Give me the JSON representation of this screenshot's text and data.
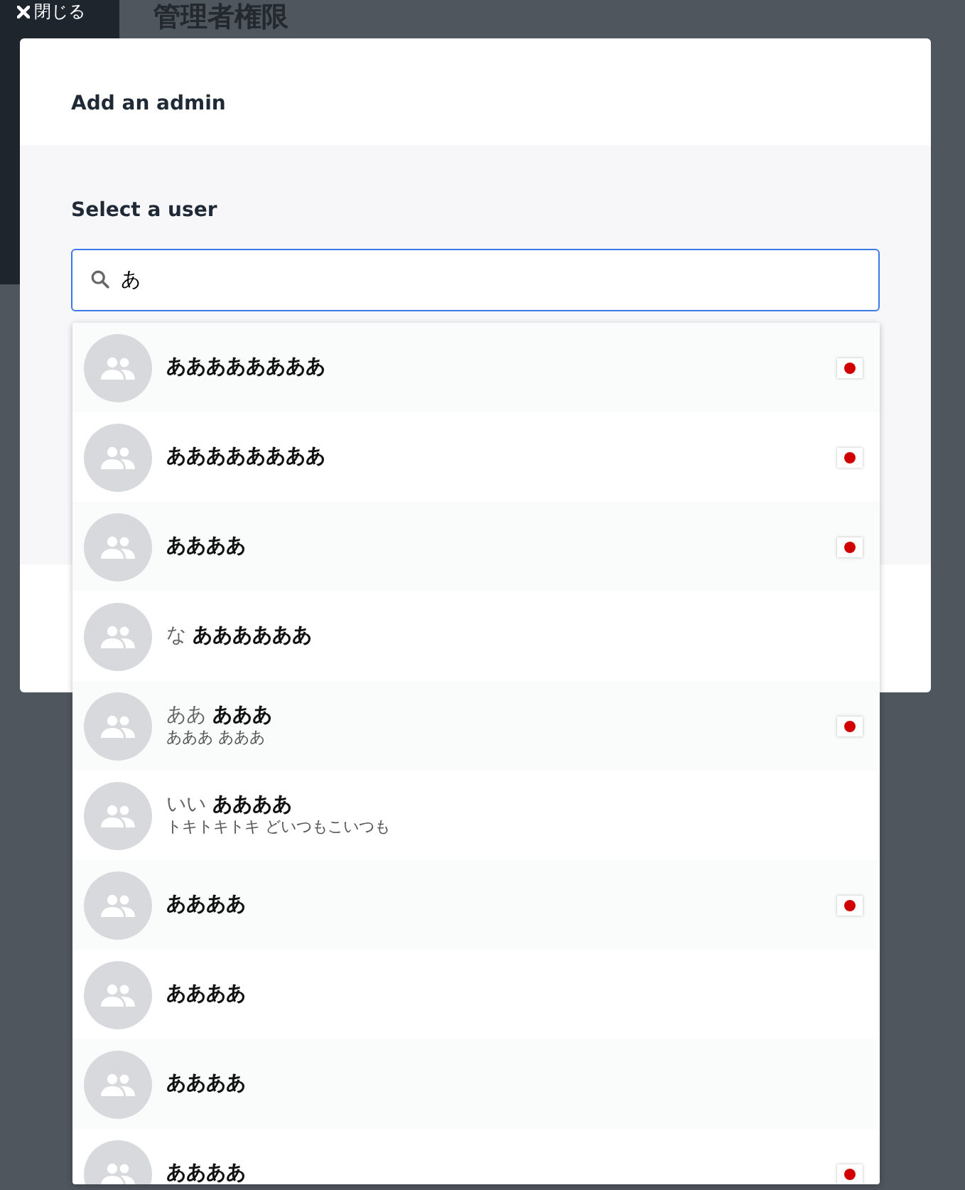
{
  "page": {
    "title": "管理者権限",
    "close_label": "閉じる"
  },
  "modal": {
    "title": "Add an admin",
    "field_label": "Select a user",
    "search": {
      "value": "あ"
    }
  },
  "results": [
    {
      "last": "ああああああああ",
      "flag": true
    },
    {
      "last": "ああああああああ",
      "flag": true
    },
    {
      "last": "ああああ",
      "flag": true
    },
    {
      "first": "な",
      "last": "ああああああ",
      "flag": false
    },
    {
      "first": "ああ",
      "last": "あああ",
      "sub": "あああ あああ",
      "flag": true
    },
    {
      "first": "いい",
      "last": "ああああ",
      "sub": "トキトキトキ どいつもこいつも",
      "flag": false
    },
    {
      "last": "ああああ",
      "flag": true
    },
    {
      "last": "ああああ",
      "flag": false
    },
    {
      "last": "ああああ",
      "flag": false
    },
    {
      "last": "ああああ",
      "flag": true
    }
  ]
}
